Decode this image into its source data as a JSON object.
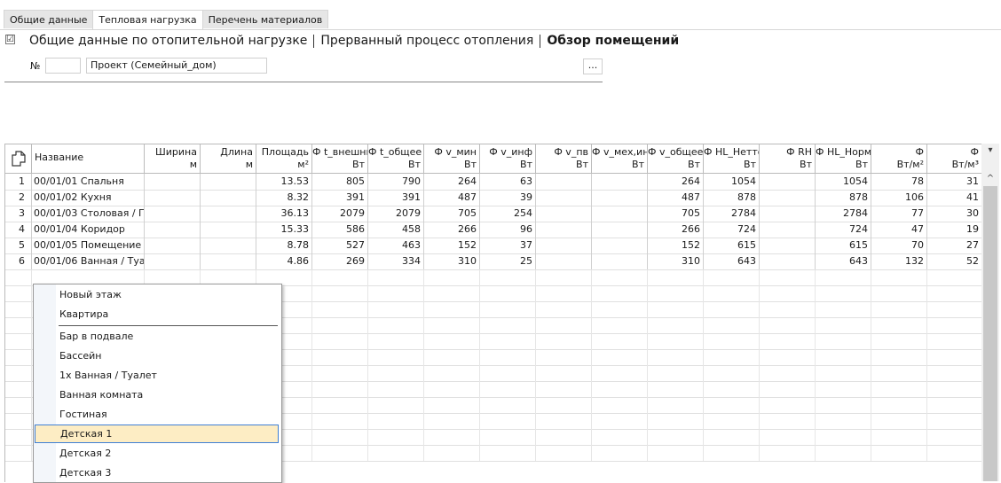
{
  "tabs": [
    "Общие данные",
    "Тепловая нагрузка",
    "Перечень материалов"
  ],
  "sections": {
    "checkbox": "☑",
    "items": [
      "Общие данные по отопительной нагрузке",
      "Прерванный процесс отопления",
      "Обзор помещений"
    ]
  },
  "number": {
    "label": "№",
    "value": ""
  },
  "project": {
    "value": "Проект (Семейный_дом)"
  },
  "more_button": "...",
  "table": {
    "headers": [
      {
        "title": "Название",
        "unit": ""
      },
      {
        "title": "Ширина",
        "unit": "м"
      },
      {
        "title": "Длина",
        "unit": "м"
      },
      {
        "title": "Площадь",
        "unit": "м²"
      },
      {
        "title": "Ф t_внешний",
        "unit": "Вт"
      },
      {
        "title": "Ф t_общее",
        "unit": "Вт"
      },
      {
        "title": "Ф v_мин",
        "unit": "Вт"
      },
      {
        "title": "Ф v_инф",
        "unit": "Вт"
      },
      {
        "title": "Ф v_пв",
        "unit": "Вт"
      },
      {
        "title": "Ф v_мех,инф",
        "unit": "Вт"
      },
      {
        "title": "Ф v_общее",
        "unit": "Вт"
      },
      {
        "title": "Ф HL_Нетто",
        "unit": "Вт"
      },
      {
        "title": "Ф RH",
        "unit": "Вт"
      },
      {
        "title": "Ф HL_Норма",
        "unit": "Вт"
      },
      {
        "title": "Ф",
        "unit": "Вт/м²"
      },
      {
        "title": "Ф",
        "unit": "Вт/м³"
      }
    ],
    "rows": [
      [
        "1",
        "00/01/01 Спальня",
        "",
        "",
        "13.53",
        "805",
        "790",
        "264",
        "63",
        "",
        "",
        "264",
        "1054",
        "",
        "1054",
        "78",
        "31"
      ],
      [
        "2",
        "00/01/02 Кухня",
        "",
        "",
        "8.32",
        "391",
        "391",
        "487",
        "39",
        "",
        "",
        "487",
        "878",
        "",
        "878",
        "106",
        "41"
      ],
      [
        "3",
        "00/01/03 Столовая / Г...",
        "",
        "",
        "36.13",
        "2079",
        "2079",
        "705",
        "254",
        "",
        "",
        "705",
        "2784",
        "",
        "2784",
        "77",
        "30"
      ],
      [
        "4",
        "00/01/04 Коридор",
        "",
        "",
        "15.33",
        "586",
        "458",
        "266",
        "96",
        "",
        "",
        "266",
        "724",
        "",
        "724",
        "47",
        "19"
      ],
      [
        "5",
        "00/01/05 Помещение ...",
        "",
        "",
        "8.78",
        "527",
        "463",
        "152",
        "37",
        "",
        "",
        "152",
        "615",
        "",
        "615",
        "70",
        "27"
      ],
      [
        "6",
        "00/01/06 Ванная / Туа...",
        "",
        "",
        "4.86",
        "269",
        "334",
        "310",
        "25",
        "",
        "",
        "310",
        "643",
        "",
        "643",
        "132",
        "52"
      ]
    ]
  },
  "context_menu": {
    "group1": [
      "Новый этаж",
      "Квартира"
    ],
    "group2": [
      "Бар в подвале",
      "Бассейн",
      "1x Ванная / Туалет",
      "Ванная комната",
      "Гостиная",
      "Детская 1",
      "Детская 2",
      "Детская 3"
    ],
    "selected": "Детская 1"
  },
  "scrollbar": {
    "up": "^",
    "menu": "▾"
  }
}
